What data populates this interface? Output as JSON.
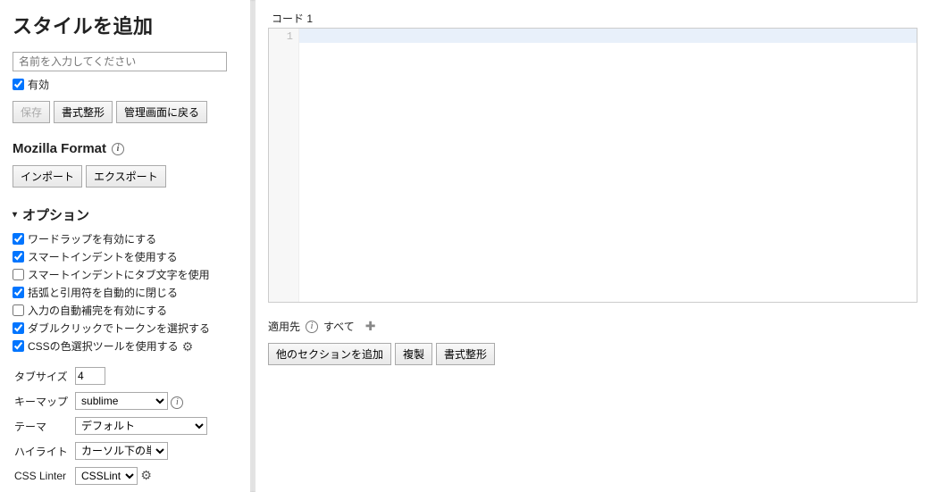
{
  "sidebar": {
    "title": "スタイルを追加",
    "name_placeholder": "名前を入力してください",
    "enabled_label": "有効",
    "actions": {
      "save": "保存",
      "beautify": "書式整形",
      "back": "管理画面に戻る"
    },
    "mozilla_section": {
      "heading": "Mozilla Format",
      "import": "インポート",
      "export": "エクスポート"
    },
    "options_heading": "オプション",
    "options": {
      "wordwrap": {
        "label": "ワードラップを有効にする",
        "checked": true
      },
      "smartindent": {
        "label": "スマートインデントを使用する",
        "checked": true
      },
      "indenttabs": {
        "label": "スマートインデントにタブ文字を使用",
        "checked": false
      },
      "autoclose": {
        "label": "括弧と引用符を自動的に閉じる",
        "checked": true
      },
      "autocomplete": {
        "label": "入力の自動補完を有効にする",
        "checked": false
      },
      "dblclick": {
        "label": "ダブルクリックでトークンを選択する",
        "checked": true
      },
      "colorpicker": {
        "label": "CSSの色選択ツールを使用する",
        "checked": true
      }
    },
    "settings": {
      "tabsize": {
        "label": "タブサイズ",
        "value": "4"
      },
      "keymap": {
        "label": "キーマップ",
        "value": "sublime"
      },
      "theme": {
        "label": "テーマ",
        "value": "デフォルト"
      },
      "highlight": {
        "label": "ハイライト",
        "value": "カーソル下の単語"
      },
      "linter": {
        "label": "CSS Linter",
        "value": "CSSLint"
      }
    }
  },
  "main": {
    "code_label": "コード 1",
    "gutter_line": "1",
    "applies_to_label": "適用先",
    "applies_to_value": "すべて",
    "buttons": {
      "add_section": "他のセクションを追加",
      "clone": "複製",
      "beautify": "書式整形"
    }
  }
}
